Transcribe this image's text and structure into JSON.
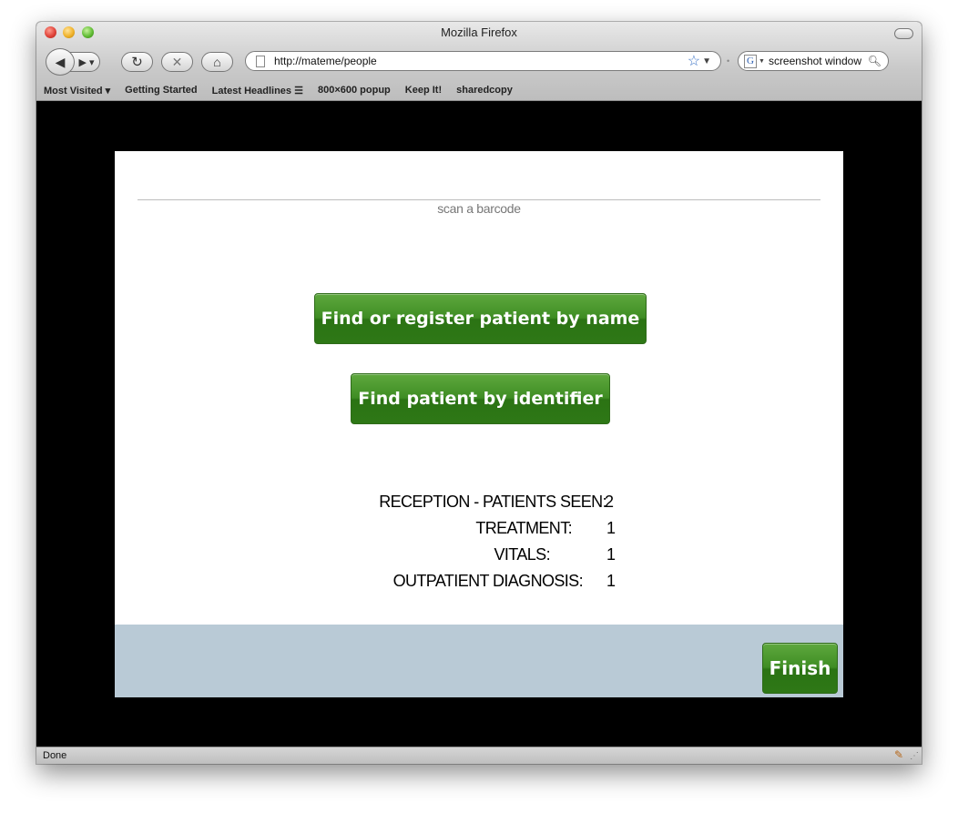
{
  "window": {
    "title": "Mozilla Firefox"
  },
  "toolbar": {
    "url": "http://mateme/people",
    "search_value": "screenshot window"
  },
  "bookmarks": [
    "Most Visited ▾",
    "Getting Started",
    "Latest Headlines ☰",
    "800×600 popup",
    "Keep It!",
    "sharedcopy"
  ],
  "page": {
    "scan_label": "scan a barcode",
    "find_by_name_label": "Find or register patient by name",
    "find_by_identifier_label": "Find patient by identifier",
    "stats": [
      {
        "label": "RECEPTION - PATIENTS SEEN:",
        "value": "2"
      },
      {
        "label": "TREATMENT:",
        "value": "1"
      },
      {
        "label": "VITALS:",
        "value": "1"
      },
      {
        "label": "OUTPATIENT DIAGNOSIS:",
        "value": "1"
      }
    ],
    "finish_label": "Finish"
  },
  "status": {
    "text": "Done"
  },
  "colors": {
    "button_green": "#3f8d24",
    "footer_bar": "#b9cad6",
    "outer_background": "#000000"
  }
}
